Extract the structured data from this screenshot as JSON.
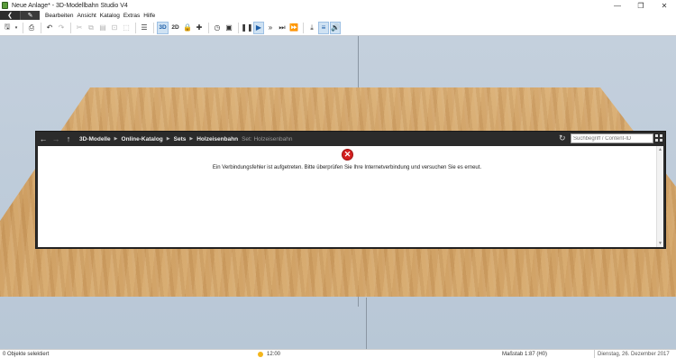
{
  "window": {
    "title": "Neue Anlage* - 3D-Modellbahn Studio V4",
    "controls": [
      "—",
      "❐",
      "✕"
    ]
  },
  "menu": {
    "items": [
      "Bearbeiten",
      "Ansicht",
      "Katalog",
      "Extras",
      "Hilfe"
    ]
  },
  "toolbar": {
    "btn_3d": "3D",
    "btn_2d": "2D"
  },
  "catalog": {
    "breadcrumb": [
      "3D-Modelle",
      "Online-Katalog",
      "Sets",
      "Holzeisenbahn"
    ],
    "subtitle": "Set: Holzeisenbahn",
    "search_placeholder": "Suchbegriff / Content-ID",
    "error_icon": "✕",
    "error_message": "Ein Verbindungsfehler ist aufgetreten. Bitte überprüfen Sie Ihre Internetverbindung und versuchen Sie es erneut."
  },
  "status": {
    "selection": "0 Objekte selektiert",
    "time": "12:00",
    "scale": "Maßstab 1:87 (H0)",
    "date": "Dienstag, 26. Dezember 2017"
  }
}
